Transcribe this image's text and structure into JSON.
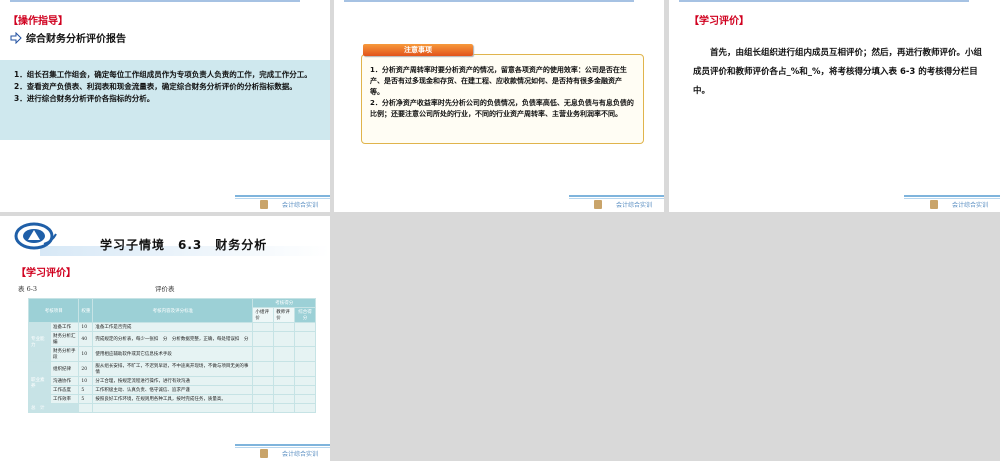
{
  "slide1": {
    "tag": "【操作指导】",
    "subtitle": "综合财务分析评价报告",
    "steps": [
      "1．组长召集工作组会，确定每位工作组成员作为专项负责人负责的工作，完成工作分工。",
      "2．查看资产负债表、利润表和现金流量表，确定综合财务分析评价的分析指标数据。",
      "3．进行综合财务分析评价各指标的分析。"
    ]
  },
  "slide2": {
    "notice_title": "注意事项",
    "items": [
      "1．分析资产周转率时要分析资产的情况，留意各项资产的使用效率：公司是否在生产、是否有过多现金和存货、在建工程、应收款情况如何、是否持有很多金融资产等。",
      "2．分析净资产收益率时先分析公司的负债情况，负债率高低、无息负债与有息负债的比例；还要注意公司所处的行业，不同的行业资产周转率、主营业务利润率不同。"
    ]
  },
  "slide3": {
    "tag": "【学习评价】",
    "paragraph": "首先，由组长组织进行组内成员互相评价；然后，再进行教师评价。小组成员评价和教师评价各占_%和_%，将考核得分填入表 6-3 的考核得分栏目中。"
  },
  "slide4": {
    "header_title": "学习子情境　6.3　财务分析",
    "tag": "【学习评价】",
    "table_caption": "表 6-3",
    "table_name": "评价表",
    "table": {
      "headers": [
        "考核项目",
        "权重",
        "考核内容及评分标准",
        "考核得分",
        "小组评价",
        "教师评价",
        "综合得分"
      ],
      "group1": "专业能力",
      "group2": "职业素养",
      "rows": [
        {
          "item": "准备工作",
          "weight": "10",
          "desc": "准备工作是否完成"
        },
        {
          "item": "财务分析汇编",
          "weight": "40",
          "desc": "完成规定的分析表，每少一张扣　分　分析数据完整，正确，每处错误扣　分"
        },
        {
          "item": "财务分析手段",
          "weight": "10",
          "desc": "使用相应辅助软件或其它信息技术手段"
        },
        {
          "item": "组织纪律",
          "weight": "20",
          "desc": "服从组长安排，不旷工，不迟到早退，不中途离开现场，不做与项目无关的事情"
        },
        {
          "item": "沟通协作",
          "weight": "10",
          "desc": "分工合理，按规定流程进行操作，进行有效沟通"
        },
        {
          "item": "工作态度",
          "weight": "5",
          "desc": "工作积极主动、认真负责、恪守诚信、追求严谨"
        },
        {
          "item": "工作效率",
          "weight": "5",
          "desc": "按照良好工作环境，在规则用各种工具，按时完成任务，质量高。"
        }
      ],
      "total_label": "总　计"
    }
  },
  "footer_brand": "会计综合实训"
}
